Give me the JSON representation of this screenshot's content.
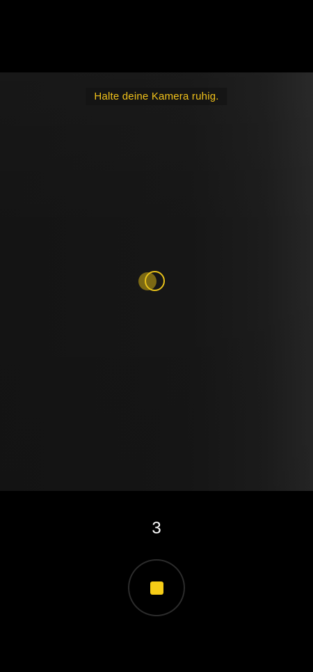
{
  "viewfinder": {
    "hint_text": "Halte deine Kamera ruhig."
  },
  "capture": {
    "countdown": "3"
  },
  "icons": {
    "level": "level-indicator-icon",
    "stop": "stop-icon"
  },
  "colors": {
    "accent": "#f5cc17",
    "background": "#000000"
  }
}
